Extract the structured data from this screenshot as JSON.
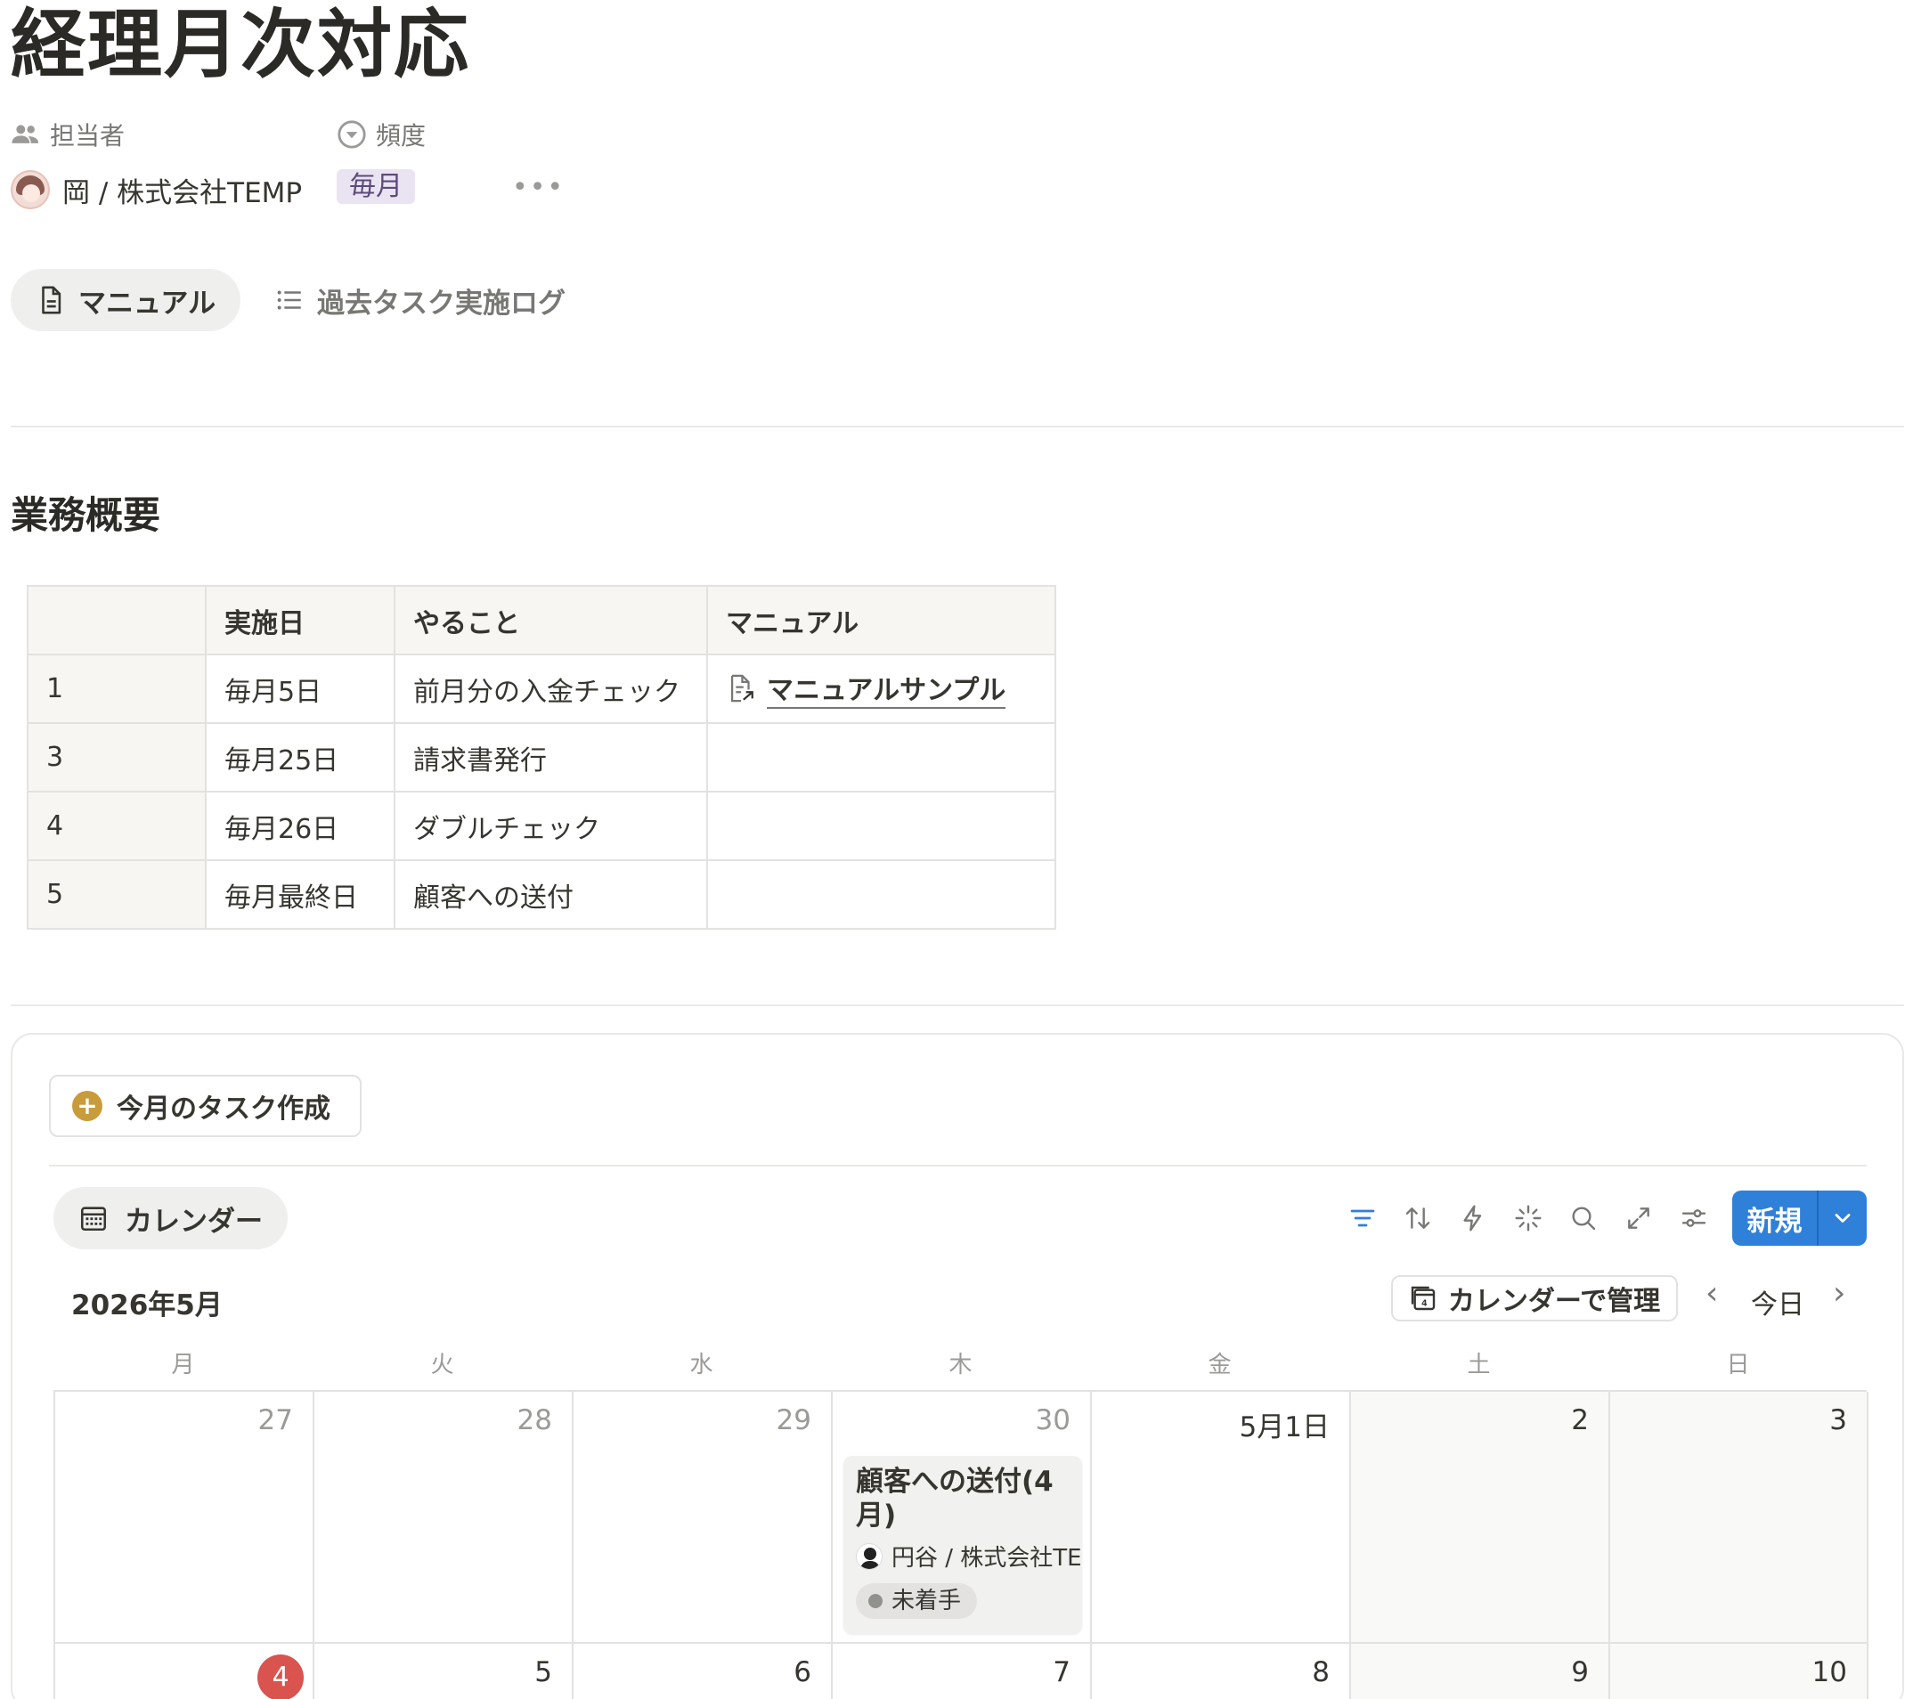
{
  "page": {
    "title": "経理月次対応"
  },
  "properties": {
    "assignee_label": "担当者",
    "assignee_value": "岡 / 株式会社TEMP",
    "frequency_label": "頻度",
    "frequency_value": "毎月",
    "more": "•••"
  },
  "tabs": [
    {
      "label": "マニュアル",
      "icon": "document-icon",
      "active": true
    },
    {
      "label": "過去タスク実施ログ",
      "icon": "list-icon",
      "active": false
    }
  ],
  "overview": {
    "heading": "業務概要",
    "headers": [
      "",
      "実施日",
      "やること",
      "マニュアル"
    ],
    "rows": [
      {
        "no": "1",
        "date": "毎月5日",
        "task": "前月分の入金チェック",
        "manual": "マニュアルサンプル"
      },
      {
        "no": "3",
        "date": "毎月25日",
        "task": "請求書発行",
        "manual": ""
      },
      {
        "no": "4",
        "date": "毎月26日",
        "task": "ダブルチェック",
        "manual": ""
      },
      {
        "no": "5",
        "date": "毎月最終日",
        "task": "顧客への送付",
        "manual": ""
      }
    ]
  },
  "database": {
    "create_button": "今月のタスク作成",
    "view_tab": "カレンダー",
    "new_button": "新規",
    "toolbar_icons": [
      "filter-icon",
      "sort-icon",
      "automation-icon",
      "ai-icon",
      "search-icon",
      "expand-icon",
      "settings-icon"
    ],
    "accent_color": "#2f80d8"
  },
  "calendar": {
    "month_label": "2026年5月",
    "manage_button": "カレンダーで管理",
    "today_button": "今日",
    "prev": "‹",
    "next": "›",
    "weekdays": [
      "月",
      "火",
      "水",
      "木",
      "金",
      "土",
      "日"
    ],
    "week1": [
      "27",
      "28",
      "29",
      "30",
      "5月1日",
      "2",
      "3"
    ],
    "week2": [
      "4",
      "5",
      "6",
      "7",
      "8",
      "9",
      "10"
    ],
    "today_date": "4",
    "today_color": "#d9534f",
    "event": {
      "title": "顧客への送付(4月)",
      "person": "円谷 / 株式会社TEMP",
      "status": "未着手"
    }
  }
}
